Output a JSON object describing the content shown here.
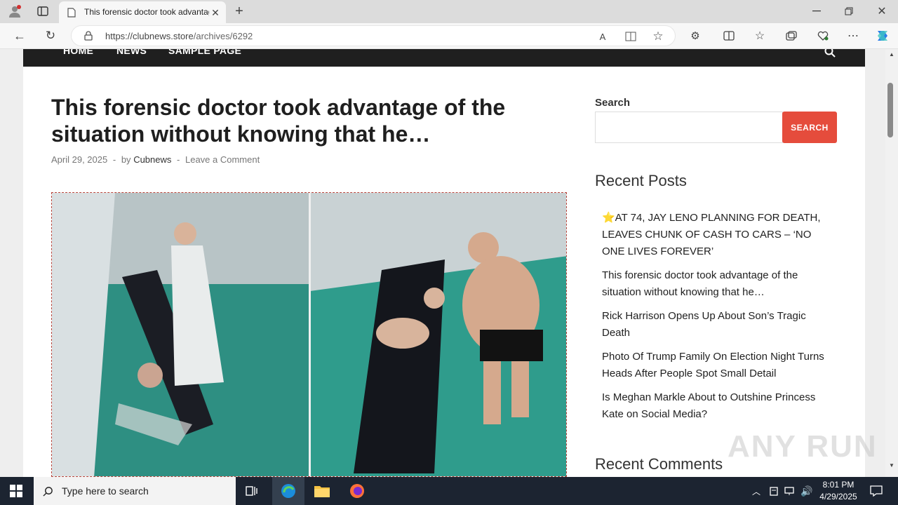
{
  "browser": {
    "tab_title": "This forensic doctor took advantage of the situation without knowing that he…",
    "url": "https://clubnews.store/archives/6292",
    "url_host": "https://clubnews.store",
    "url_path": "/archives/6292"
  },
  "site": {
    "nav": [
      "HOME",
      "NEWS",
      "SAMPLE PAGE"
    ],
    "post": {
      "title": "This forensic doctor took advantage of the situation without knowing that he…",
      "date": "April 29, 2025",
      "by": "by",
      "author": "Cubnews",
      "comment_link": "Leave a Comment",
      "separator": "-"
    },
    "sidebar": {
      "search_label": "Search",
      "search_button": "SEARCH",
      "recent_posts_title": "Recent Posts",
      "recent_posts": [
        "⭐AT 74, JAY LENO PLANNING FOR DEATH, LEAVES CHUNK OF CASH TO CARS – ‘NO ONE LIVES FOREVER’",
        "This forensic doctor took advantage of the situation without knowing that he…",
        "Rick Harrison Opens Up About Son’s Tragic Death",
        "Photo Of Trump Family On Election Night Turns Heads After People Spot Small Detail",
        "Is Meghan Markle About to Outshine Princess Kate on Social Media?"
      ],
      "recent_comments_title": "Recent Comments"
    }
  },
  "taskbar": {
    "search_placeholder": "Type here to search",
    "time": "8:01 PM",
    "date": "4/29/2025"
  },
  "watermark": "ANY RUN",
  "colors": {
    "accent": "#e54c3c",
    "navbar": "#1f1f1f",
    "taskbar": "#1c2431"
  }
}
